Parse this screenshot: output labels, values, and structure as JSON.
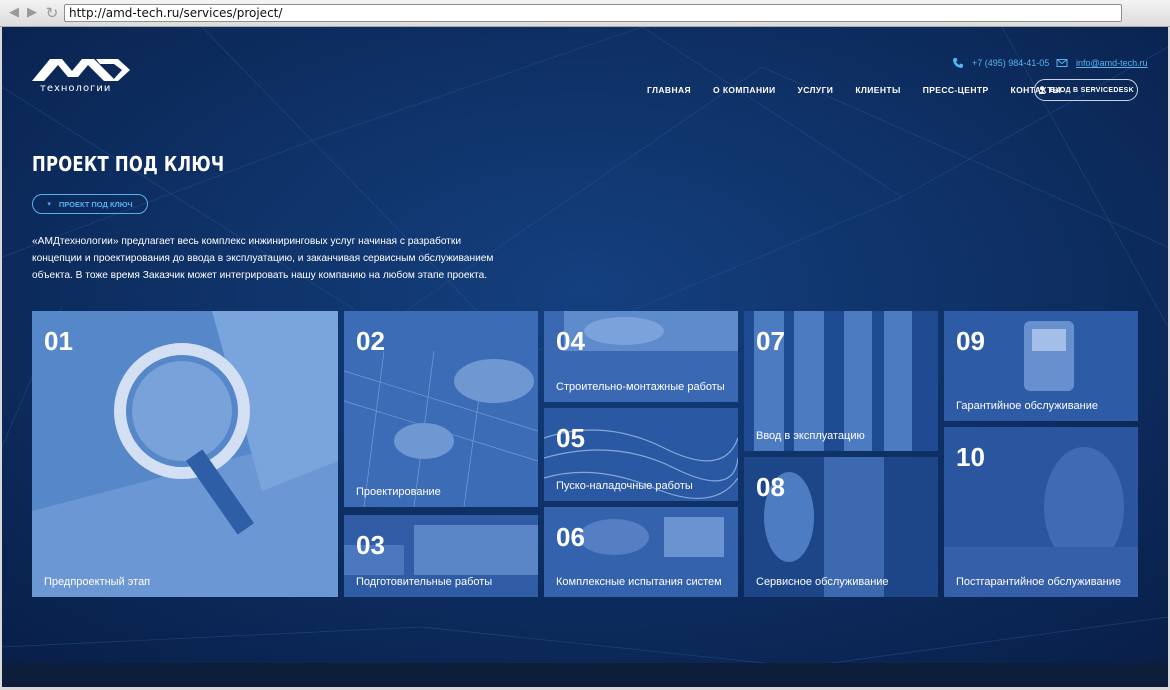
{
  "browser": {
    "url": "http://amd-tech.ru/services/project/"
  },
  "header": {
    "logo_text": "АМД",
    "logo_sub": "технологии",
    "phone": "+7 (495) 984-41-05",
    "email": "info@amd-tech.ru",
    "menu": [
      "ГЛАВНАЯ",
      "О КОМПАНИИ",
      "УСЛУГИ",
      "КЛИЕНТЫ",
      "ПРЕСС-ЦЕНТР",
      "КОНТАКТЫ"
    ],
    "servicedesk_label": "ВХОД В SERVICEDESK"
  },
  "page": {
    "title": "ПРОЕКТ ПОД КЛЮЧ",
    "dropdown_label": "ПРОЕКТ ПОД КЛЮЧ",
    "intro": "«АМДтехнологии» предлагает весь комплекс инжиниринговых услуг начиная с разработки концепции и проектирования до ввода в эксплуатацию, и заканчивая сервисным обслуживанием объекта. В тоже время Заказчик может интегрировать нашу компанию на любом этапе проекта."
  },
  "tiles": [
    {
      "num": "01",
      "caption": "Предпроектный этап"
    },
    {
      "num": "02",
      "caption": "Проектирование"
    },
    {
      "num": "03",
      "caption": "Подготовительные работы"
    },
    {
      "num": "04",
      "caption": "Строительно-монтажные работы"
    },
    {
      "num": "05",
      "caption": "Пуско-наладочные работы"
    },
    {
      "num": "06",
      "caption": "Комплексные испытания систем"
    },
    {
      "num": "07",
      "caption": "Ввод в эксплуатацию"
    },
    {
      "num": "08",
      "caption": "Сервисное обслуживание"
    },
    {
      "num": "09",
      "caption": "Гарантийное обслуживание"
    },
    {
      "num": "10",
      "caption": "Постгарантийное обслуживание"
    }
  ],
  "colors": {
    "background": "#0a2a5c",
    "accent": "#56b4ef",
    "tile": "#2c5aa6"
  }
}
